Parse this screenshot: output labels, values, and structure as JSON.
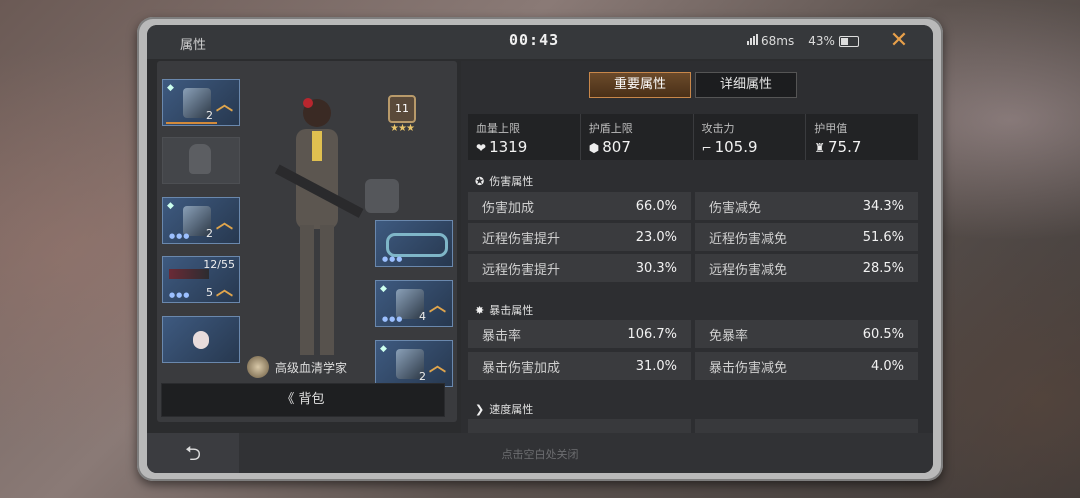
{
  "header": {
    "title": "属性",
    "clock": "00:43",
    "ping": "68ms",
    "battery": "43%",
    "battery_level": 0.43,
    "close_icon": "close-x-icon"
  },
  "equipment": {
    "slots_left": [
      {
        "name": "helmet",
        "count": "2",
        "filled": true
      },
      {
        "name": "backpack-empty",
        "filled": false
      },
      {
        "name": "armor",
        "count": "2",
        "filled": true
      },
      {
        "name": "weapon",
        "ammo": "12/55",
        "count": "5",
        "filled": true
      },
      {
        "name": "pet",
        "filled": true
      }
    ],
    "slots_right": [
      {
        "name": "ring",
        "filled": true
      },
      {
        "name": "gloves",
        "count": "4",
        "filled": true
      },
      {
        "name": "boots",
        "count": "2",
        "filled": true
      }
    ],
    "rank_level": "11",
    "rank_stars": "★★★",
    "player_title": "高级血清学家",
    "backpack_button": "《 背包"
  },
  "tabs": [
    {
      "label": "重要属性",
      "active": true
    },
    {
      "label": "详细属性",
      "active": false
    }
  ],
  "summary": [
    {
      "label": "血量上限",
      "value": "1319",
      "icon": "heart-icon"
    },
    {
      "label": "护盾上限",
      "value": "807",
      "icon": "shield-icon"
    },
    {
      "label": "攻击力",
      "value": "105.9",
      "icon": "gun-icon"
    },
    {
      "label": "护甲值",
      "value": "75.7",
      "icon": "armor-icon"
    }
  ],
  "sections": {
    "damage": {
      "title": "伤害属性",
      "rows": [
        [
          {
            "k": "伤害加成",
            "v": "66.0%"
          },
          {
            "k": "伤害减免",
            "v": "34.3%"
          }
        ],
        [
          {
            "k": "近程伤害提升",
            "v": "23.0%"
          },
          {
            "k": "近程伤害减免",
            "v": "51.6%"
          }
        ],
        [
          {
            "k": "远程伤害提升",
            "v": "30.3%"
          },
          {
            "k": "远程伤害减免",
            "v": "28.5%"
          }
        ]
      ]
    },
    "crit": {
      "title": "暴击属性",
      "rows": [
        [
          {
            "k": "暴击率",
            "v": "106.7%"
          },
          {
            "k": "免暴率",
            "v": "60.5%"
          }
        ],
        [
          {
            "k": "暴击伤害加成",
            "v": "31.0%"
          },
          {
            "k": "暴击伤害减免",
            "v": "4.0%"
          }
        ]
      ]
    },
    "speed": {
      "title": "速度属性"
    }
  },
  "footer": {
    "hint": "点击空白处关闭",
    "back_icon": "return-arrow-icon"
  }
}
